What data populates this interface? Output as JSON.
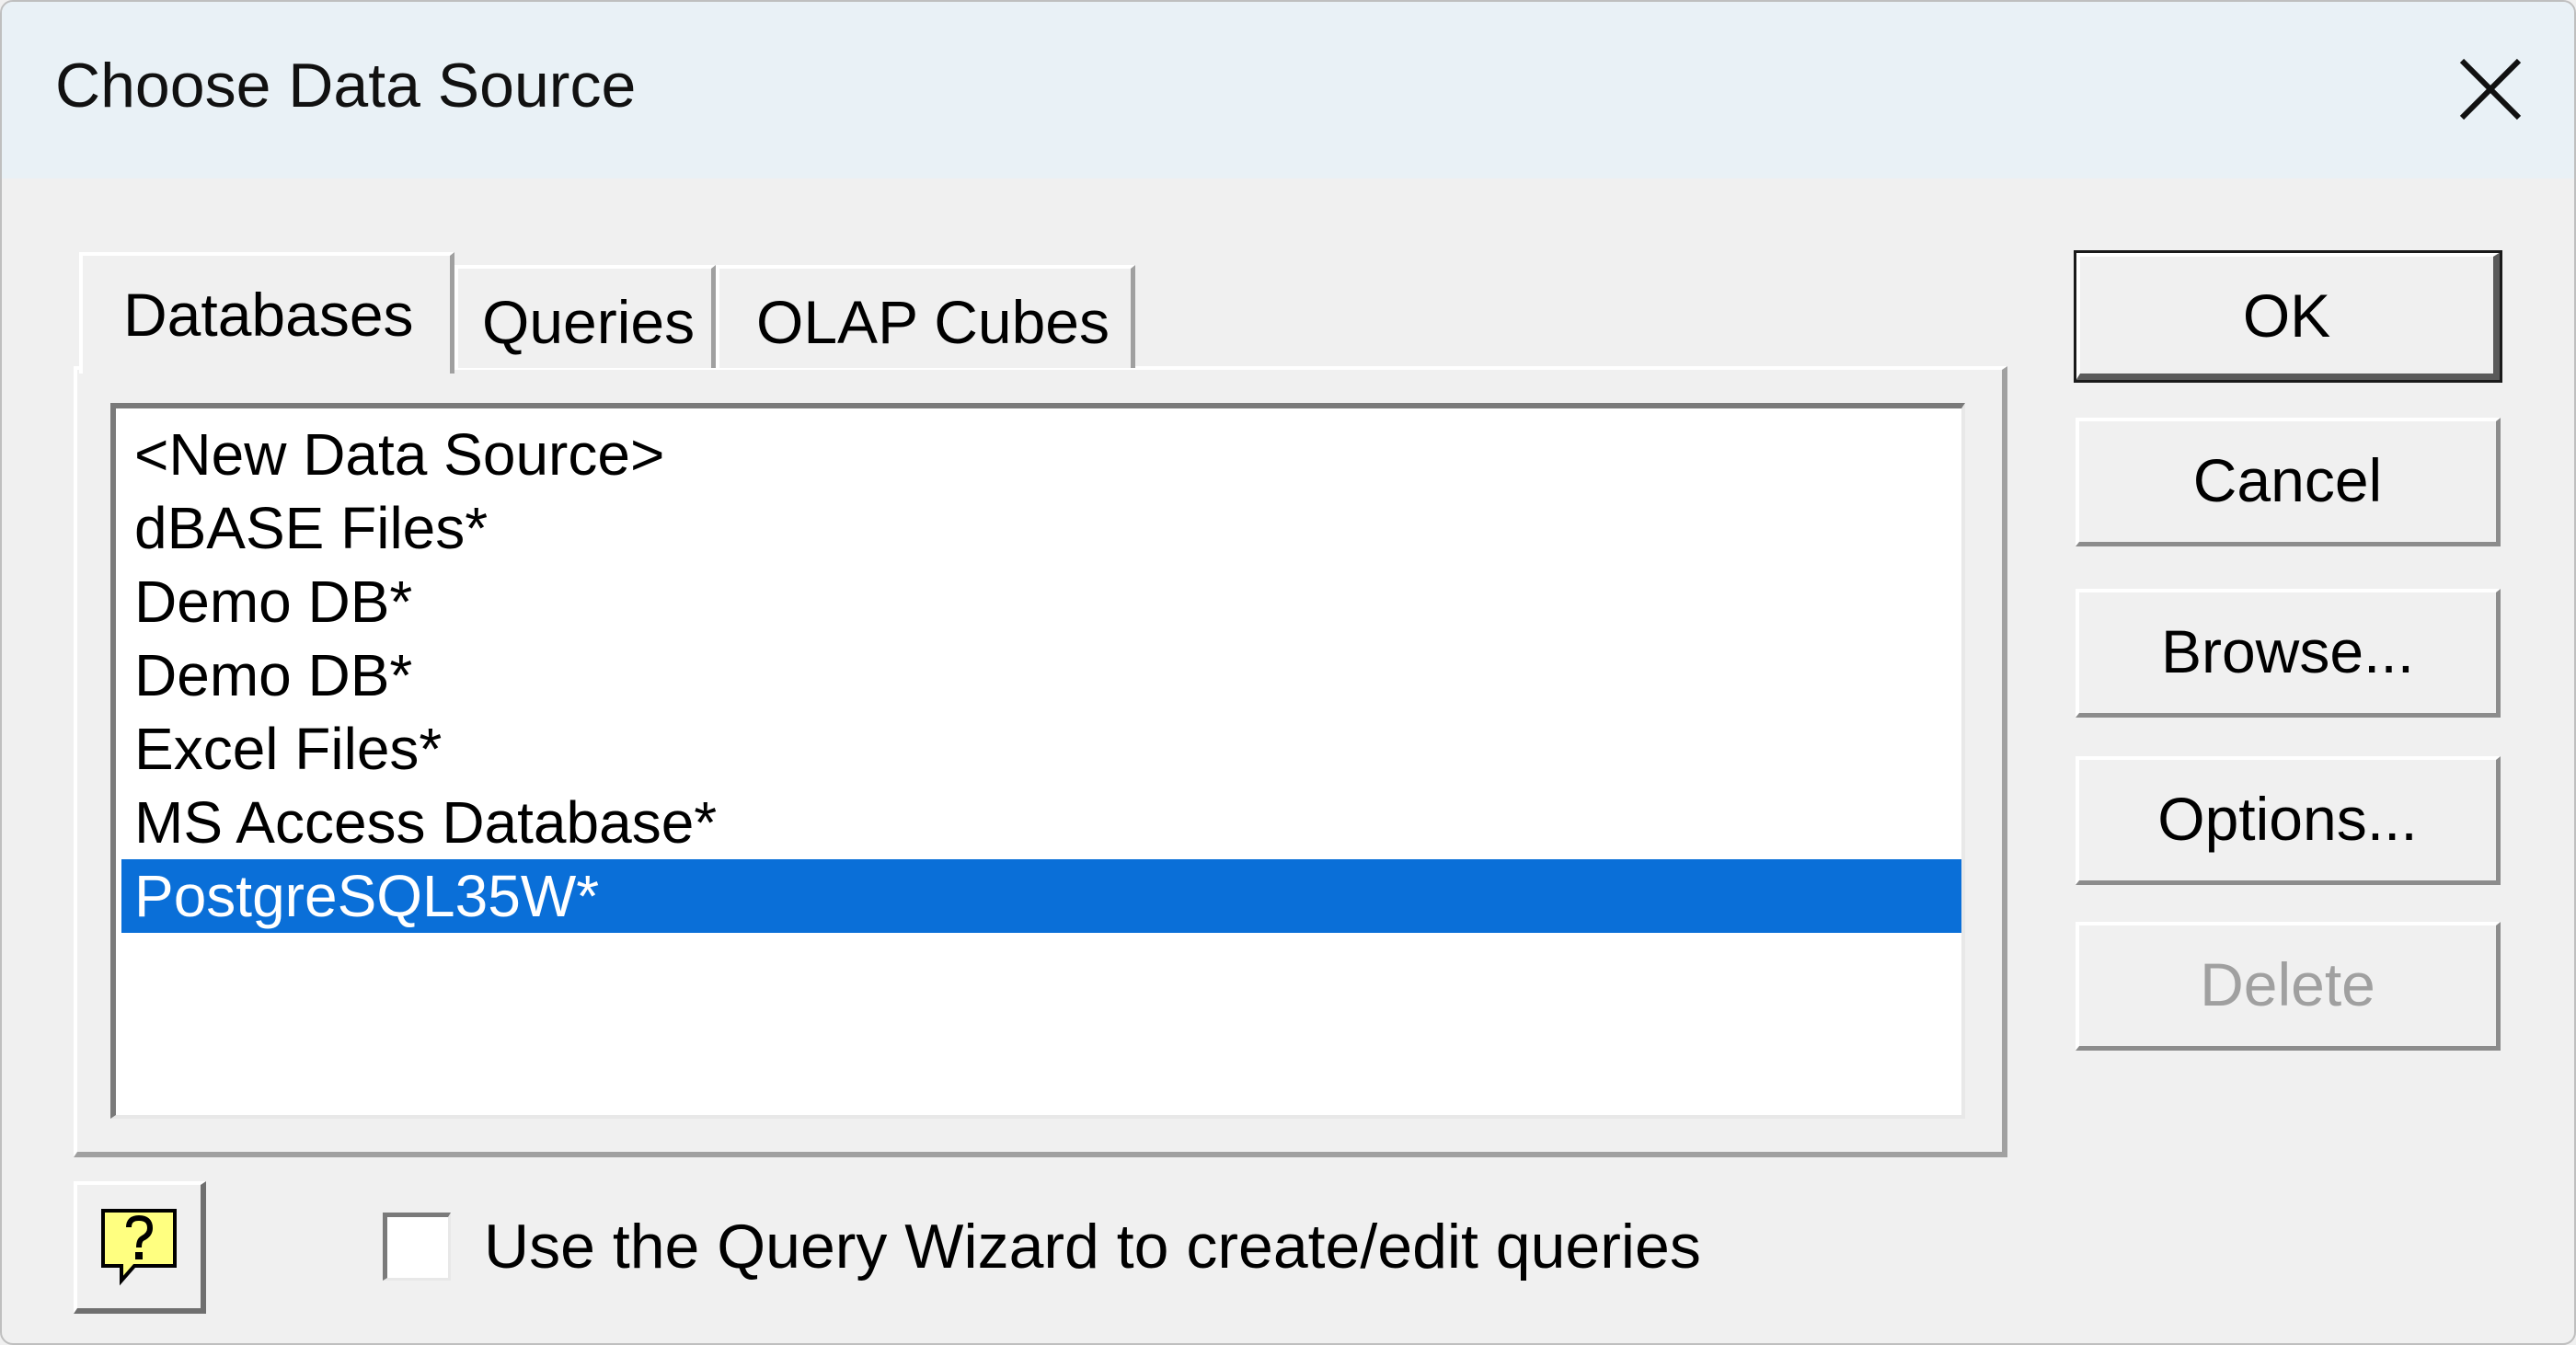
{
  "window": {
    "title": "Choose Data Source",
    "close_icon": "close-icon"
  },
  "tabs": [
    {
      "label": "Databases",
      "selected": true
    },
    {
      "label": "Queries",
      "selected": false
    },
    {
      "label": "OLAP Cubes",
      "selected": false
    }
  ],
  "data_sources": [
    {
      "label": "<New Data Source>",
      "selected": false
    },
    {
      "label": "dBASE Files*",
      "selected": false
    },
    {
      "label": "Demo DB*",
      "selected": false
    },
    {
      "label": "Demo DB*",
      "selected": false
    },
    {
      "label": "Excel Files*",
      "selected": false
    },
    {
      "label": "MS Access Database*",
      "selected": false
    },
    {
      "label": "PostgreSQL35W*",
      "selected": true
    }
  ],
  "buttons": {
    "ok": "OK",
    "cancel": "Cancel",
    "browse": "Browse...",
    "options": "Options...",
    "delete": "Delete"
  },
  "help": {
    "icon": "help-icon"
  },
  "query_wizard": {
    "label": "Use the Query Wizard to create/edit queries",
    "checked": false
  },
  "colors": {
    "selection": "#0a6fd8",
    "titlebar": "#e9f1f6",
    "dialog_bg": "#f0f0f0",
    "help_icon_bg": "#ffff80"
  }
}
